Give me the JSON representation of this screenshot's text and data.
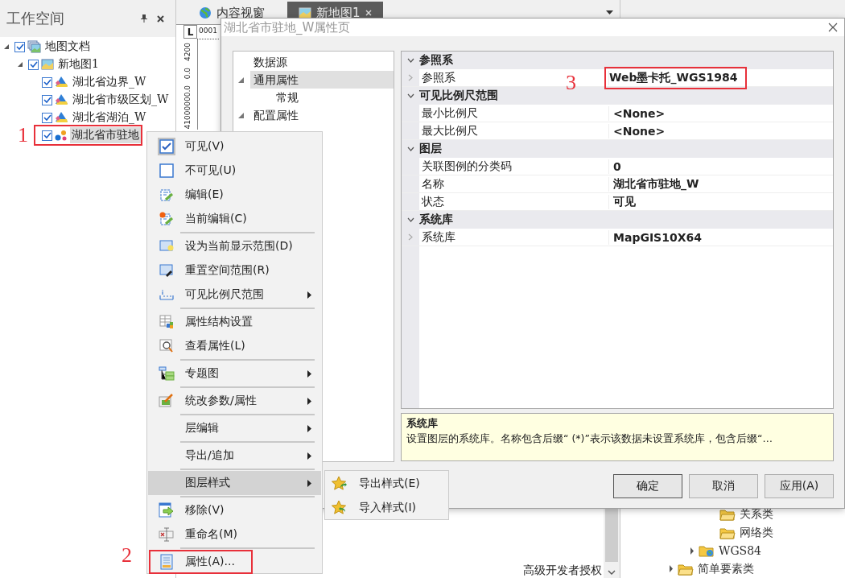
{
  "workspace": {
    "title": "工作空间",
    "tree": [
      {
        "label": "地图文档",
        "kind": "document",
        "checked": true,
        "expanded": true,
        "selected": false,
        "children": [
          {
            "label": "新地图1",
            "kind": "map",
            "checked": true,
            "expanded": true,
            "selected": false,
            "children": [
              {
                "label": "湖北省边界_W",
                "kind": "polygon",
                "checked": true,
                "selected": false
              },
              {
                "label": "湖北省市级区划_W",
                "kind": "polygon",
                "checked": true,
                "selected": false
              },
              {
                "label": "湖北省湖泊_W",
                "kind": "polygon",
                "checked": true,
                "selected": false
              },
              {
                "label": "湖北省市驻地",
                "kind": "point",
                "checked": true,
                "selected": true
              }
            ]
          }
        ]
      }
    ]
  },
  "document_tabs": [
    {
      "label": "内容视窗",
      "selected": false
    },
    {
      "label": "新地图1",
      "selected": true
    }
  ],
  "ruler": {
    "corner": "L",
    "top_label": "0001",
    "side_labels": [
      "4200",
      "0.0",
      "41000000.0"
    ]
  },
  "status_text": "高级开发者授权",
  "catalog": {
    "tree": [
      {
        "children": [
          {
            "children": [
              {
                "label": "关系类"
              },
              {
                "label": "网络类"
              }
            ]
          },
          {
            "label": "WGS84",
            "kind": "coordinate",
            "expanded": false
          }
        ]
      },
      {
        "label": "简单要素类",
        "expanded": false
      }
    ]
  },
  "dialog": {
    "title": "湖北省市驻地_W属性页",
    "nav": [
      {
        "label": "数据源",
        "selected": false
      },
      {
        "label": "通用属性",
        "expanded": true,
        "selected": true,
        "children": [
          {
            "label": "常规",
            "selected": false
          }
        ]
      },
      {
        "label": "配置属性",
        "expanded": true,
        "selected": false
      }
    ],
    "categories": [
      {
        "name": "参照系",
        "expanded": true,
        "rows": [
          {
            "name": "参照系",
            "value": "Web墨卡托_WGS1984",
            "expandable": true
          }
        ]
      },
      {
        "name": "可见比例尺范围",
        "expanded": true,
        "rows": [
          {
            "name": "最小比例尺",
            "value": "<None>",
            "expandable": false
          },
          {
            "name": "最大比例尺",
            "value": "<None>",
            "expandable": false
          }
        ]
      },
      {
        "name": "图层",
        "expanded": true,
        "rows": [
          {
            "name": "关联图例的分类码",
            "value": "0",
            "expandable": false
          },
          {
            "name": "名称",
            "value": "湖北省市驻地_W",
            "expandable": false
          },
          {
            "name": "状态",
            "value": "可见",
            "expandable": false
          }
        ]
      },
      {
        "name": "系统库",
        "expanded": true,
        "rows": [
          {
            "name": "系统库",
            "value": "MapGIS10X64",
            "expandable": true
          }
        ]
      }
    ],
    "description": {
      "title": "系统库",
      "text": "设置图层的系统库。名称包含后缀“ (*)”表示该数据未设置系统库，包含后缀“…"
    },
    "buttons": [
      {
        "label": "确定",
        "default": true
      },
      {
        "label": "取消",
        "default": false
      },
      {
        "label": "应用(A)",
        "default": false
      }
    ]
  },
  "context_menu": {
    "groups": [
      [
        {
          "label": "可见(V)",
          "has_submenu": false,
          "selected": false
        },
        {
          "label": "不可见(U)",
          "has_submenu": false,
          "selected": false
        },
        {
          "label": "编辑(E)",
          "has_submenu": false,
          "selected": false
        },
        {
          "label": "当前编辑(C)",
          "has_submenu": false,
          "selected": false
        }
      ],
      [
        {
          "label": "设为当前显示范围(D)",
          "has_submenu": false,
          "selected": false
        },
        {
          "label": "重置空间范围(R)",
          "has_submenu": false,
          "selected": false
        },
        {
          "label": "可见比例尺范围",
          "has_submenu": true,
          "selected": false
        }
      ],
      [
        {
          "label": "属性结构设置",
          "has_submenu": false,
          "selected": false
        },
        {
          "label": "查看属性(L)",
          "has_submenu": false,
          "selected": false
        }
      ],
      [
        {
          "label": "专题图",
          "has_submenu": true,
          "selected": false
        }
      ],
      [
        {
          "label": "统改参数/属性",
          "has_submenu": true,
          "selected": false
        }
      ],
      [
        {
          "label": "层编辑",
          "has_submenu": true,
          "selected": false
        }
      ],
      [
        {
          "label": "导出/追加",
          "has_submenu": true,
          "selected": false
        }
      ],
      [
        {
          "label": "图层样式",
          "has_submenu": true,
          "selected": true
        }
      ],
      [
        {
          "label": "移除(V)",
          "has_submenu": false,
          "selected": false
        },
        {
          "label": "重命名(M)",
          "has_submenu": false,
          "selected": false
        }
      ],
      [
        {
          "label": "属性(A)...",
          "has_submenu": false,
          "selected": false
        }
      ]
    ],
    "submenu": [
      {
        "label": "导出样式(E)"
      },
      {
        "label": "导入样式(I)"
      }
    ]
  },
  "annotations": [
    {
      "label": "1"
    },
    {
      "label": "2"
    },
    {
      "label": "3"
    }
  ]
}
